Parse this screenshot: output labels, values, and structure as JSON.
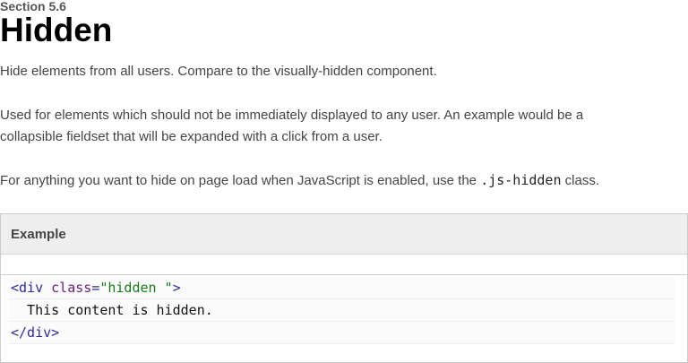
{
  "section": "Section 5.6",
  "title": "Hidden",
  "paragraphs": {
    "p1": "Hide elements from all users. Compare to the visually-hidden component.",
    "p2_line1": "Used for elements which should not be immediately displayed to any user. An example would be a",
    "p2_line2": "collapsible fieldset that will be expanded with a click from a user.",
    "p3_before": "For anything you want to hide on page load when JavaScript is enabled, use the ",
    "p3_code": ".js-hidden",
    "p3_after": " class."
  },
  "example": {
    "header": "Example",
    "code": {
      "line1_open": "<div ",
      "line1_attr": "class",
      "line1_eq": "=",
      "line1_value": "\"hidden \"",
      "line1_close": ">",
      "line2": "  This content is hidden.",
      "line3": "</div>"
    }
  },
  "colors": {
    "tag": "#2f2a99",
    "attribute": "#6b1f7a",
    "string": "#1a7a1a",
    "header_bg": "#eeeeee"
  }
}
